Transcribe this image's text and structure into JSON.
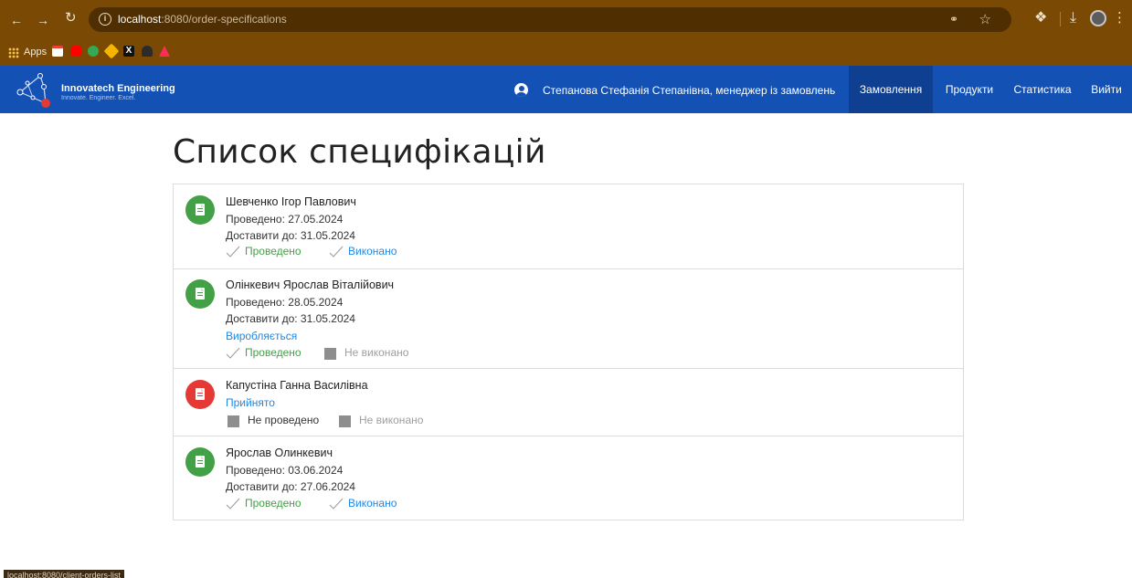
{
  "browser": {
    "url_host": "localhost",
    "url_path": ":8080/order-specifications",
    "bookmarks_apps_label": "Apps",
    "status_bar_url": "localhost:8080/client-orders-list"
  },
  "header": {
    "brand_name": "Innovatech Engineering",
    "brand_tagline": "Innovate. Engineer. Excel.",
    "user_label": "Степанова Стефанія Степанівна, менеджер із замовлень",
    "nav": {
      "orders": "Замовлення",
      "products": "Продукти",
      "statistics": "Статистика",
      "logout": "Вийти"
    }
  },
  "page": {
    "title": "Список специфікацій"
  },
  "specifications": [
    {
      "name": "Шевченко Ігор Павлович",
      "conducted_date": "Проведено: 27.05.2024",
      "deliver_by": "Доставити до: 31.05.2024",
      "stage": "",
      "conducted_label": "Проведено",
      "done_label": "Виконано"
    },
    {
      "name": "Олінкевич Ярослав Віталійович",
      "conducted_date": "Проведено: 28.05.2024",
      "deliver_by": "Доставити до: 31.05.2024",
      "stage": "Виробляється",
      "conducted_label": "Проведено",
      "done_label": "Не виконано"
    },
    {
      "name": "Капустіна Ганна Василівна",
      "conducted_date": "",
      "deliver_by": "",
      "stage": "Прийнято",
      "conducted_label": "Не проведено",
      "done_label": "Не виконано"
    },
    {
      "name": "Ярослав Олинкевич",
      "conducted_date": "Проведено: 03.06.2024",
      "deliver_by": "Доставити до: 27.06.2024",
      "stage": "",
      "conducted_label": "Проведено",
      "done_label": "Виконано"
    }
  ],
  "colors": {
    "browser_frame": "#7a4a05",
    "header_blue": "#1351b4",
    "nav_active": "#0e3f91",
    "status_green": "#43a047",
    "status_red": "#e53935",
    "link_blue": "#1e88e5",
    "inactive_gray": "#8e8e8e"
  },
  "icons": {
    "back": "arrow-left-icon",
    "forward": "arrow-right-icon",
    "reload": "reload-icon",
    "site_info": "info-icon",
    "user": "user-circle-icon",
    "spec": "document-icon",
    "conducted_done": "check-icon",
    "not_done": "gray-square-icon"
  }
}
